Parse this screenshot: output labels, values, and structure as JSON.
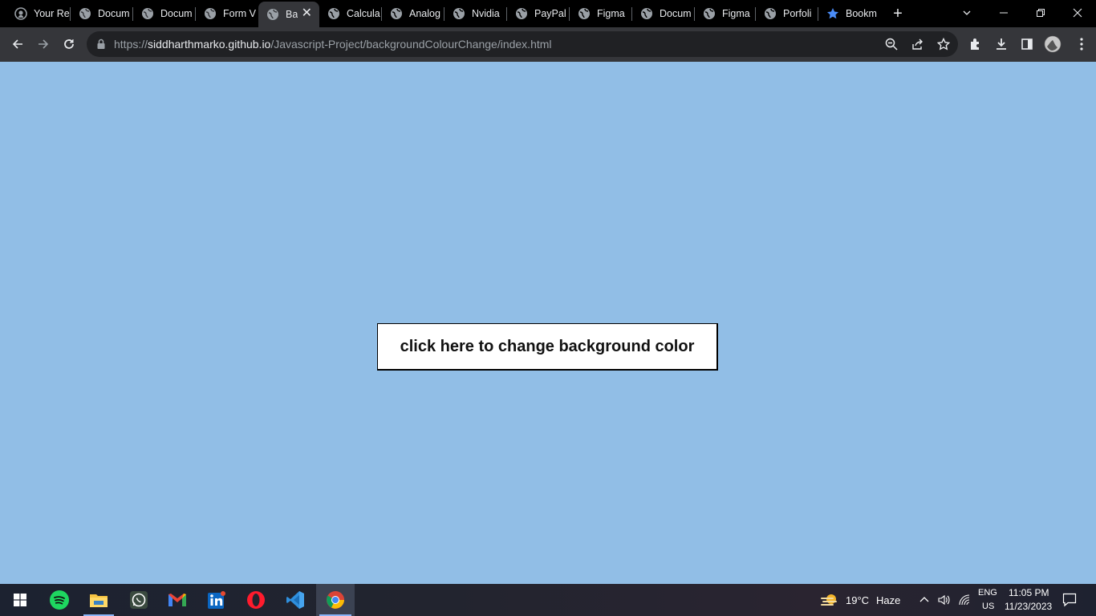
{
  "browser": {
    "tabs": [
      {
        "title": "Your Re",
        "icon": "github-icon"
      },
      {
        "title": "Docum",
        "icon": "globe-icon"
      },
      {
        "title": "Docum",
        "icon": "globe-icon"
      },
      {
        "title": "Form V",
        "icon": "globe-icon"
      },
      {
        "title": "Ba",
        "icon": "globe-icon",
        "active": true
      },
      {
        "title": "Calcula",
        "icon": "globe-icon"
      },
      {
        "title": "Analog",
        "icon": "globe-icon"
      },
      {
        "title": "Nvidia",
        "icon": "globe-icon"
      },
      {
        "title": "PayPal",
        "icon": "globe-icon"
      },
      {
        "title": "Figma",
        "icon": "globe-icon"
      },
      {
        "title": "Docum",
        "icon": "globe-icon"
      },
      {
        "title": "Figma",
        "icon": "globe-icon"
      },
      {
        "title": "Porfoli",
        "icon": "globe-icon"
      },
      {
        "title": "Bookm",
        "icon": "star-icon"
      }
    ],
    "close_tab_glyph": "✕",
    "new_tab_glyph": "+",
    "url_scheme": "https://",
    "url_host": "siddharthmarko.github.io",
    "url_path": "/Javascript-Project/backgroundColourChange/index.html"
  },
  "page": {
    "background_color": "#91bee6",
    "button_label": "click here to change background color"
  },
  "taskbar": {
    "apps": [
      "windows-start-icon",
      "spotify-icon",
      "file-explorer-icon",
      "whatsapp-icon",
      "gmail-icon",
      "linkedin-icon",
      "opera-icon",
      "vscode-icon",
      "chrome-icon"
    ],
    "weather_temp": "19°C",
    "weather_desc": "Haze",
    "lang": "ENG",
    "region": "US",
    "time": "11:05 PM",
    "date": "11/23/2023"
  }
}
